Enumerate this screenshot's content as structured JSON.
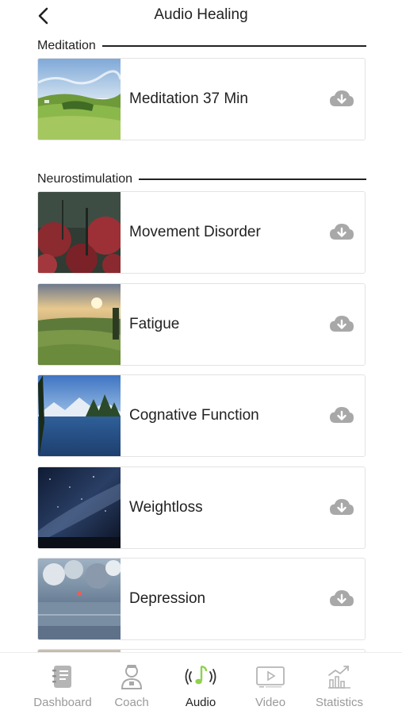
{
  "header": {
    "title": "Audio Healing"
  },
  "sections": [
    {
      "label": "Meditation"
    },
    {
      "label": "Neurostimulation"
    }
  ],
  "tracks": [
    {
      "title": "Meditation 37 Min",
      "thumb": "hills"
    },
    {
      "title": "Movement Disorder",
      "thumb": "red-forest"
    },
    {
      "title": "Fatigue",
      "thumb": "sunset-meadow"
    },
    {
      "title": "Cognative Function",
      "thumb": "mountain-lake"
    },
    {
      "title": "Weightloss",
      "thumb": "night-sky"
    },
    {
      "title": "Depression",
      "thumb": "cloudy-sea"
    }
  ],
  "download_icon": "cloud-download-icon",
  "tabs": [
    {
      "label": "Dashboard",
      "icon": "notebook-icon",
      "active": false
    },
    {
      "label": "Coach",
      "icon": "coach-icon",
      "active": false
    },
    {
      "label": "Audio",
      "icon": "audio-note-icon",
      "active": true
    },
    {
      "label": "Video",
      "icon": "video-icon",
      "active": false
    },
    {
      "label": "Statistics",
      "icon": "statistics-icon",
      "active": false
    }
  ],
  "colors": {
    "accent": "#8fd14f",
    "inactive_tab": "#9a9a9a",
    "download_icon": "#a8a8a8"
  }
}
